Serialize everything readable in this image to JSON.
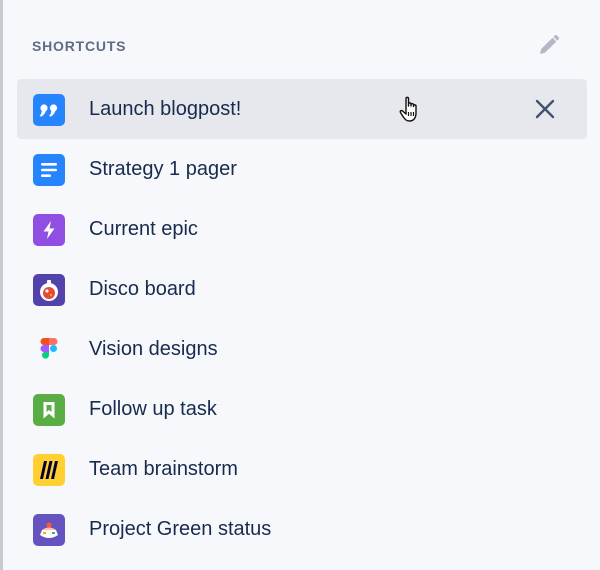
{
  "header": {
    "title": "SHORTCUTS",
    "edit_icon": "pencil-icon"
  },
  "shortcuts": [
    {
      "label": "Launch blogpost!",
      "icon": "quote-icon",
      "color": "#2684ff",
      "active": true
    },
    {
      "label": "Strategy 1 pager",
      "icon": "document-icon",
      "color": "#2684ff"
    },
    {
      "label": "Current epic",
      "icon": "lightning-icon",
      "color": "#904ee2"
    },
    {
      "label": "Disco board",
      "icon": "board-avatar-icon",
      "color": "#5243aa"
    },
    {
      "label": "Vision designs",
      "icon": "figma-icon",
      "color": "#f24e1e"
    },
    {
      "label": "Follow up task",
      "icon": "bookmark-icon",
      "color": "#5aac44"
    },
    {
      "label": "Team brainstorm",
      "icon": "miro-icon",
      "color": "#ffd02f"
    },
    {
      "label": "Project Green status",
      "icon": "cake-avatar-icon",
      "color": "#6554c0"
    }
  ],
  "remove_icon": "close-icon",
  "colors": {
    "background": "#f7f8fc",
    "active_row": "#e6e8ed",
    "text": "#172b4d",
    "muted": "#5e6c84"
  }
}
